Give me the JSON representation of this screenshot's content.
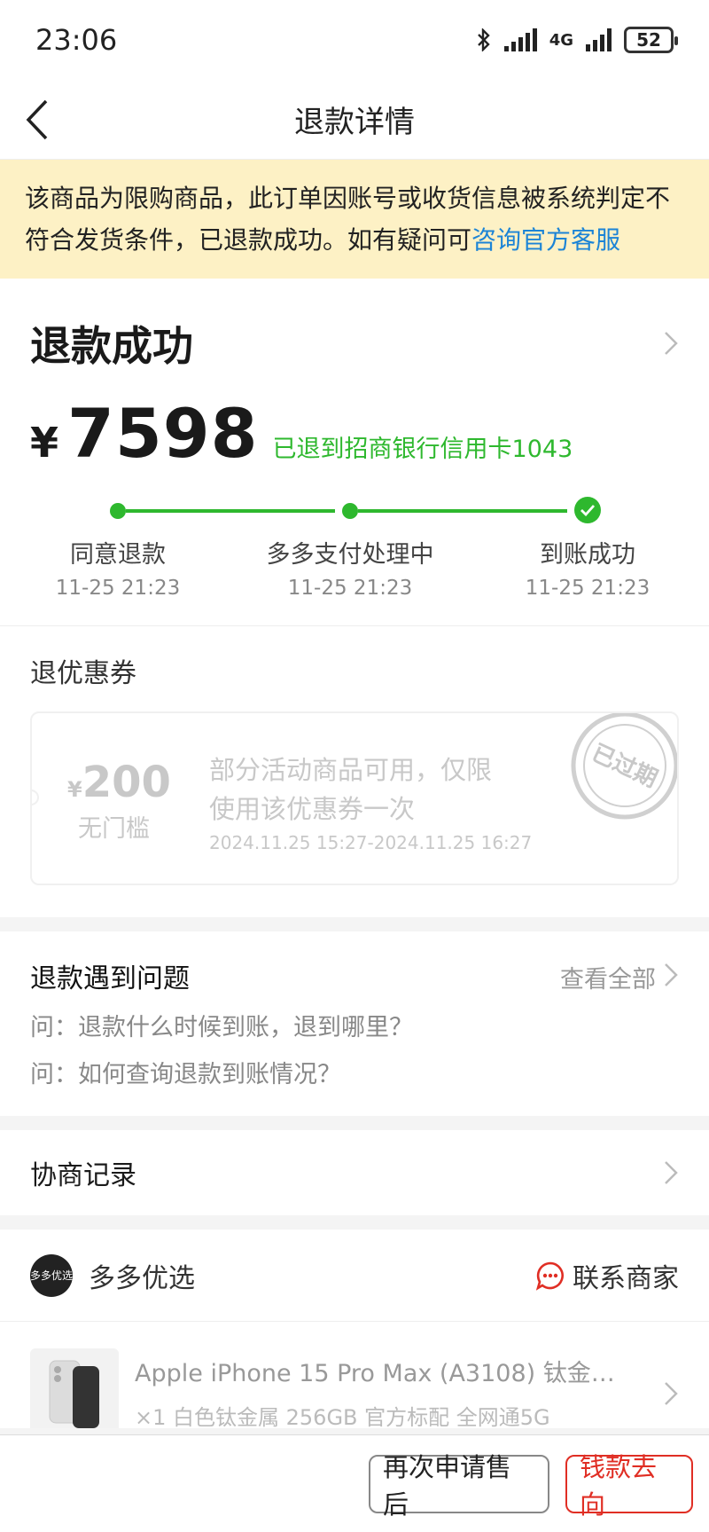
{
  "status_bar": {
    "time": "23:06",
    "network": "4G",
    "battery": "52"
  },
  "nav": {
    "title": "退款详情"
  },
  "notice": {
    "text": "该商品为限购商品，此订单因账号或收货信息被系统判定不符合发货条件，已退款成功。如有疑问可",
    "link": "咨询官方客服"
  },
  "refund": {
    "status": "退款成功",
    "currency": "¥",
    "amount": "7598",
    "destination": "已退到招商银行信用卡1043",
    "steps": [
      {
        "label": "同意退款",
        "time": "11-25 21:23"
      },
      {
        "label": "多多支付处理中",
        "time": "11-25 21:23"
      },
      {
        "label": "到账成功",
        "time": "11-25 21:23"
      }
    ],
    "accent_color": "#2eb82e"
  },
  "coupon": {
    "section_title": "退优惠券",
    "currency": "¥",
    "amount": "200",
    "threshold": "无门槛",
    "description": "部分活动商品可用，仅限使用该优惠券一次",
    "validity": "2024.11.25 15:27-2024.11.25 16:27",
    "stamp": "已过期"
  },
  "faq": {
    "title": "退款遇到问题",
    "view_all": "查看全部",
    "questions": [
      "问：退款什么时候到账，退到哪里？",
      "问：如何查询退款到账情况？"
    ]
  },
  "negotiation": {
    "label": "协商记录"
  },
  "shop": {
    "logo_text": "多多优选",
    "name": "多多优选",
    "contact": "联系商家"
  },
  "product": {
    "title": "Apple iPhone 15 Pro Max (A3108) 钛金属 …",
    "spec": "×1 白色钛金属 256GB 官方标配 全网通5G"
  },
  "actions": {
    "reapply": "再次申请售后",
    "money_flow": "钱款去向",
    "brand_red": "#e02e24"
  }
}
